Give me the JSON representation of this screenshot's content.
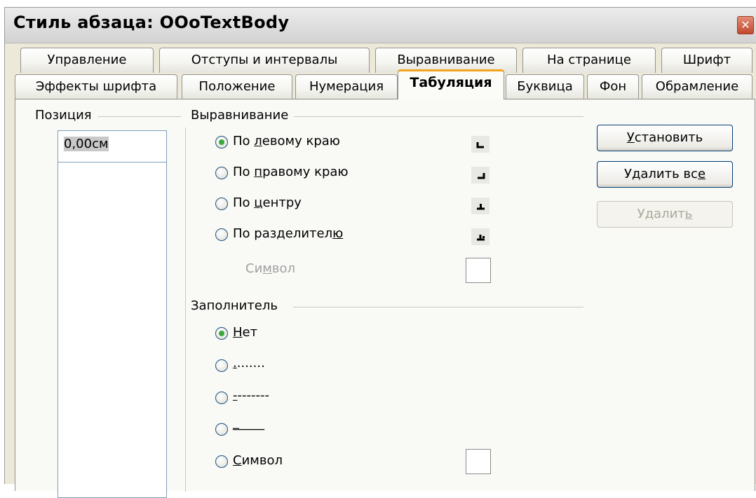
{
  "window": {
    "title": "Стиль абзаца: OOoTextBody",
    "close_glyph": "✕"
  },
  "tabs_row1": [
    "Управление",
    "Отступы и интервалы",
    "Выравнивание",
    "На странице",
    "Шрифт"
  ],
  "tabs_row2": [
    "Эффекты шрифта",
    "Положение",
    "Нумерация",
    "Табуляция",
    "Буквица",
    "Фон",
    "Обрамление"
  ],
  "active_tab": "Табуляция",
  "position": {
    "heading": "Позиция",
    "value": "0,00см"
  },
  "alignment": {
    "heading": "Выравнивание",
    "left": {
      "pre": "По ",
      "acc": "л",
      "post": "евому краю",
      "checked": true,
      "icon": "tab-left-icon"
    },
    "right": {
      "pre": "По ",
      "acc": "п",
      "post": "равому краю",
      "checked": false,
      "icon": "tab-right-icon"
    },
    "center": {
      "pre": "По ",
      "acc": "ц",
      "post": "ентру",
      "checked": false,
      "icon": "tab-center-icon"
    },
    "decimal": {
      "pre": "По разделител",
      "acc": "ю",
      "post": "",
      "checked": false,
      "icon": "tab-decimal-icon"
    },
    "symbol": {
      "pre": "Си",
      "acc": "м",
      "post": "вол"
    }
  },
  "fill": {
    "heading": "Заполнитель",
    "none": {
      "acc": "Н",
      "post": "ет",
      "checked": true
    },
    "dots": {
      "acc": ".",
      "post": ".......",
      "checked": false
    },
    "dashes": {
      "acc": "-",
      "post": "-------",
      "checked": false
    },
    "underline": {
      "acc": "_",
      "post": "____",
      "checked": false
    },
    "symbol": {
      "acc": "С",
      "post": "имвол",
      "checked": false
    }
  },
  "buttons": {
    "set": {
      "acc": "У",
      "post": "становить"
    },
    "delete_all": {
      "pre": "Удалить вс",
      "acc": "е",
      "post": ""
    },
    "delete": {
      "pre": "Удалит",
      "acc": "ь",
      "post": ""
    }
  },
  "colors": {
    "accent_tab": "#f3a41c",
    "radio_checked": "#3aa83a",
    "button_border": "#003c74"
  }
}
